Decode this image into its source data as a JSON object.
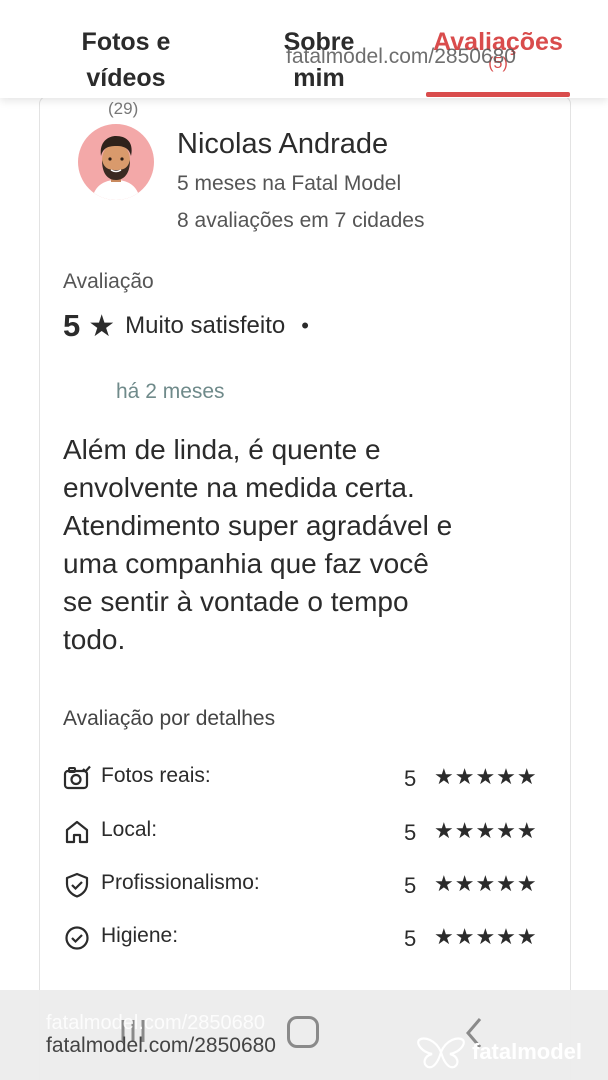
{
  "tabs": {
    "photos": {
      "line1": "Fotos e",
      "line2": "vídeos",
      "count": "(29)"
    },
    "about": {
      "line1": "Sobre",
      "line2": "mim"
    },
    "reviews": {
      "label": "Avaliações",
      "count": "(5)",
      "active": true
    }
  },
  "watermark": {
    "text": "fatalmodel.com/2850680",
    "brand": "fatalmodel"
  },
  "reviewer": {
    "name": "Nicolas Andrade",
    "since": "5 meses na Fatal Model",
    "reviews_summary": "8 avaliações em 7 cidades"
  },
  "rating": {
    "label": "Avaliação",
    "score": "5",
    "star": "★",
    "text": "Muito satisfeito",
    "separator": "•",
    "time": "há 2 meses"
  },
  "review_text": "Além de linda, é quente e\nenvolvente na medida certa.\nAtendimento super agradável e\numa companhia que faz você\nse sentir à vontade o tempo\ntodo.",
  "details": {
    "title": "Avaliação por detalhes",
    "items": [
      {
        "icon": "camera-check-icon",
        "label": "Fotos reais:",
        "score": "5",
        "stars": "★★★★★"
      },
      {
        "icon": "home-icon",
        "label": "Local:",
        "score": "5",
        "stars": "★★★★★"
      },
      {
        "icon": "shield-check-icon",
        "label": "Profissionalismo:",
        "score": "5",
        "stars": "★★★★★"
      },
      {
        "icon": "circle-check-icon",
        "label": "Higiene:",
        "score": "5",
        "stars": "★★★★★"
      }
    ]
  },
  "colors": {
    "accent": "#d94c4c",
    "avatar_bg": "#f3a8a8",
    "text": "#2b2b2b",
    "muted": "#6f8a8a"
  }
}
